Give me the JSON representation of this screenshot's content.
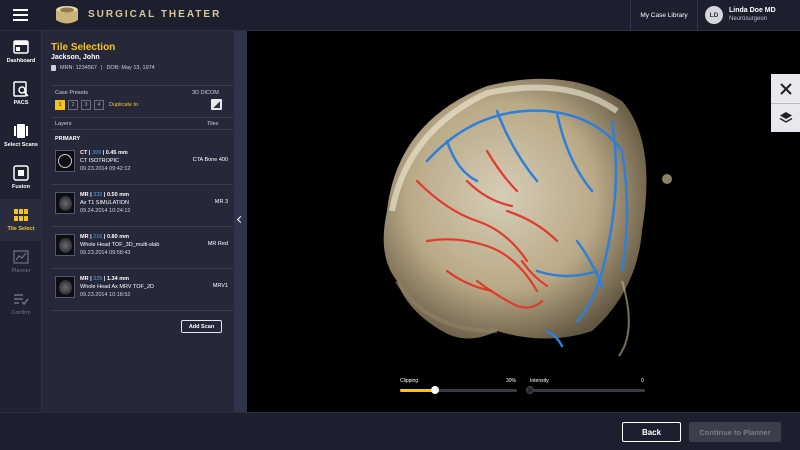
{
  "app": {
    "brand": "SURGICAL THEATER"
  },
  "header": {
    "case_library": "My Case Library",
    "user": {
      "initials": "LD",
      "name": "Linda Doe MD",
      "role": "Neurosurgeon"
    }
  },
  "nav": {
    "items": [
      {
        "label": "Dashboard",
        "icon": "dashboard-icon",
        "state": "normal"
      },
      {
        "label": "PACS",
        "icon": "pacs-icon",
        "state": "normal"
      },
      {
        "label": "Select Scans",
        "icon": "scans-icon",
        "state": "normal"
      },
      {
        "label": "Fusion",
        "icon": "fusion-icon",
        "state": "normal"
      },
      {
        "label": "Tile Select",
        "icon": "grid-icon",
        "state": "active"
      },
      {
        "label": "Planner",
        "icon": "chart-icon",
        "state": "disabled"
      },
      {
        "label": "Confirm",
        "icon": "checklist-icon",
        "state": "disabled"
      }
    ]
  },
  "panel": {
    "title": "Tile Selection",
    "patient_name": "Jackson, John",
    "mrn": "MRN: 1234567",
    "dob": "DOB: May 13, 1974",
    "case_presets_label": "Case Presets",
    "dicom_label": "3D DICOM",
    "presets": [
      "1",
      "2",
      "3",
      "4"
    ],
    "active_preset": "1",
    "duplicate_label": "Duplicate to",
    "layers_header": "Layers",
    "tiles_header": "Tiles",
    "primary_label": "PRIMARY",
    "layers": [
      {
        "modality": "CT",
        "count": "399",
        "thickness": "0.45 mm",
        "name": "CT ISOTROPIC",
        "date": "09.23.2014 09:42:12",
        "tile": "CTA Bone 400",
        "thumb": "ring"
      },
      {
        "modality": "MR",
        "count": "332",
        "thickness": "0.50 mm",
        "name": "Ax T1 SIMULATION",
        "date": "09.24.2014 10:24:12",
        "tile": "MR 3",
        "thumb": "brain"
      },
      {
        "modality": "MR",
        "count": "216",
        "thickness": "0.80 mm",
        "name": "Whole Head TOF_3D_multi-slab",
        "date": "09.23.2014 09:58:43",
        "tile": "MR Red",
        "thumb": "brain"
      },
      {
        "modality": "MR",
        "count": "325",
        "thickness": "1.34 mm",
        "name": "Whole Head Ax MRV TOF_2D",
        "date": "09.23.2014 10:18:52",
        "tile": "MRV1",
        "thumb": "brain"
      }
    ],
    "add_scan": "Add Scan"
  },
  "viewer": {
    "clipping_label": "Clipping",
    "clipping_value": "30%",
    "clipping_fraction": 0.3,
    "intensity_label": "Intensity",
    "intensity_value": "0",
    "intensity_fraction": 0
  },
  "footer": {
    "back": "Back",
    "continue": "Continue to Planner"
  },
  "colors": {
    "accent": "#f4c41e",
    "artery": "#e03a2c",
    "vein": "#2f7fd8",
    "link_number": "#4aa8e8"
  }
}
